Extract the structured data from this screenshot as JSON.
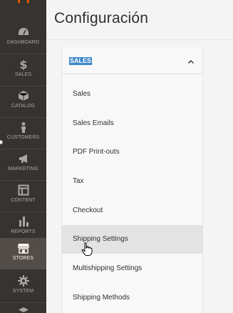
{
  "nav": {
    "items": [
      {
        "label": "DASHBOARD",
        "icon": "dashboard-icon"
      },
      {
        "label": "SALES",
        "icon": "dollar-icon"
      },
      {
        "label": "CATALOG",
        "icon": "cube-icon"
      },
      {
        "label": "CUSTOMERS",
        "icon": "person-icon"
      },
      {
        "label": "MARKETING",
        "icon": "megaphone-icon"
      },
      {
        "label": "CONTENT",
        "icon": "layout-icon"
      },
      {
        "label": "REPORTS",
        "icon": "bar-chart-icon"
      },
      {
        "label": "STORES",
        "icon": "storefront-icon"
      },
      {
        "label": "SYSTEM",
        "icon": "gear-icon"
      }
    ],
    "active": "STORES"
  },
  "page": {
    "title": "Configuración"
  },
  "section": {
    "title": "SALES",
    "items": [
      {
        "label": "Sales"
      },
      {
        "label": "Sales Emails"
      },
      {
        "label": "PDF Print-outs"
      },
      {
        "label": "Tax"
      },
      {
        "label": "Checkout"
      },
      {
        "label": "Shipping Settings"
      },
      {
        "label": "Multishipping Settings"
      },
      {
        "label": "Shipping Methods"
      }
    ],
    "hovered": "Shipping Settings"
  },
  "colors": {
    "nav_bg": "#373330",
    "nav_active": "#524d49",
    "accent": "#eb5202",
    "selection": "#3a86c9"
  }
}
